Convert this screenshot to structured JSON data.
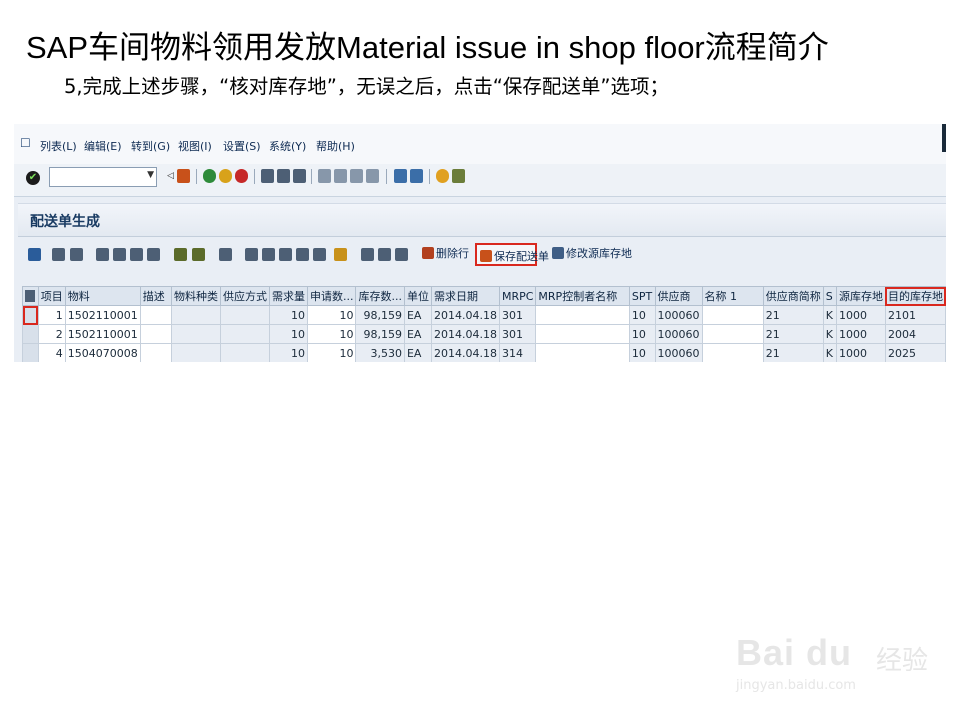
{
  "slide": {
    "title": "SAP车间物料领用发放Material issue in shop floor流程简介",
    "subtitle": "5,完成上述步骤，“核对库存地”，无误之后，点击“保存配送单”选项；"
  },
  "menubar": {
    "items": [
      "列表(L)",
      "编辑(E)",
      "转到(G)",
      "视图(I)",
      "设置(S)",
      "系统(Y)",
      "帮助(H)"
    ]
  },
  "command_field": {
    "value": ""
  },
  "screen": {
    "title": "配送单生成"
  },
  "toolbar": {
    "delete_row_label": "删除行",
    "save_delivery_label": "保存配送单",
    "modify_source_label": "修改源库存地"
  },
  "table": {
    "columns": [
      "项目",
      "物料",
      "描述",
      "物料种类",
      "供应方式",
      "需求量",
      "申请数...",
      "库存数...",
      "单位",
      "需求日期",
      "MRPC",
      "MRP控制者名称",
      "SPT",
      "供应商",
      "名称 1",
      "供应商简称",
      "S",
      "源库存地",
      "目的库存地"
    ],
    "rows": [
      [
        "1",
        "1502110001",
        "",
        "",
        "",
        "10",
        "10",
        "98,159",
        "EA",
        "2014.04.18",
        "301",
        "",
        "10",
        "100060",
        "",
        "21",
        "K",
        "1000",
        "2101"
      ],
      [
        "2",
        "1502110001",
        "",
        "",
        "",
        "10",
        "10",
        "98,159",
        "EA",
        "2014.04.18",
        "301",
        "",
        "10",
        "100060",
        "",
        "21",
        "K",
        "1000",
        "2004"
      ],
      [
        "4",
        "1504070008",
        "",
        "",
        "",
        "10",
        "10",
        "3,530",
        "EA",
        "2014.04.18",
        "314",
        "",
        "10",
        "100060",
        "",
        "21",
        "K",
        "1000",
        "2025"
      ]
    ]
  },
  "watermark": {
    "brand": "Bai du",
    "brand_cn": "经验",
    "url": "jingyan.baidu.com"
  },
  "colors": {
    "highlight": "#d9281e",
    "title_blue": "#183a62"
  }
}
